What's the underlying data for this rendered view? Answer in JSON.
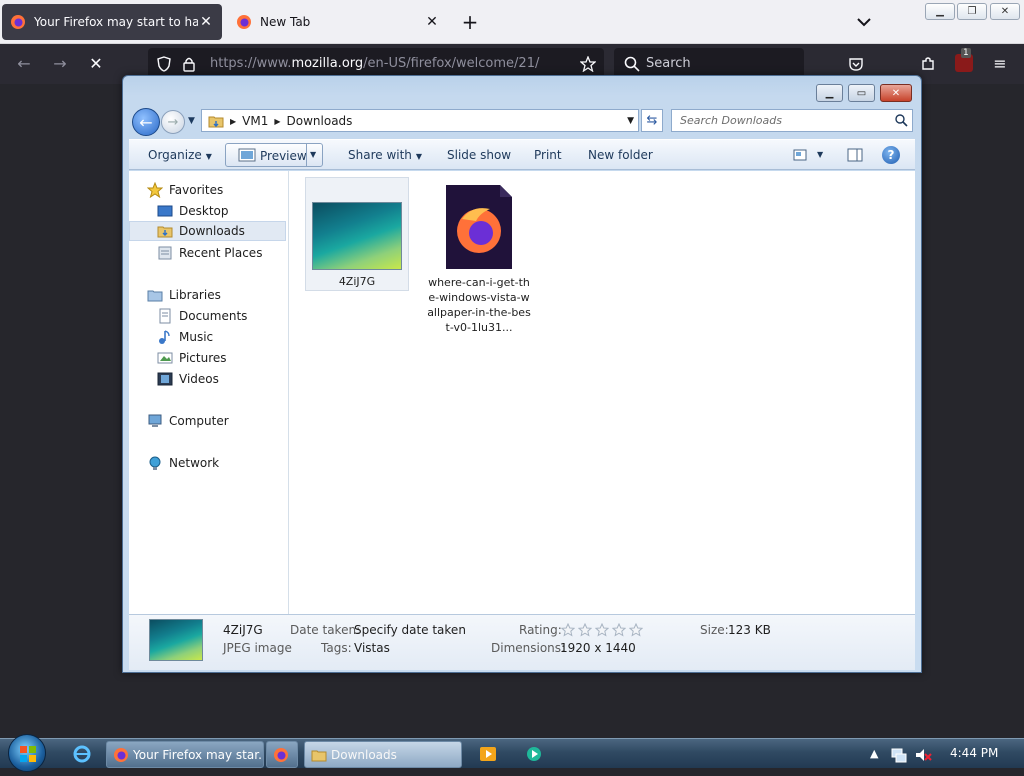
{
  "firefox": {
    "tabs": [
      {
        "label": "Your Firefox may start to have p",
        "active": true
      },
      {
        "label": "New Tab",
        "active": false
      }
    ],
    "url": {
      "prefix": "https://www.",
      "domain": "mozilla.org",
      "path": "/en-US/firefox/welcome/21/"
    },
    "search_placeholder": "Search",
    "badge_count": "1"
  },
  "explorer": {
    "breadcrumbs": [
      "VM1",
      "Downloads"
    ],
    "search_placeholder": "Search Downloads",
    "commands": {
      "organize": "Organize",
      "preview": "Preview",
      "share_with": "Share with",
      "slide_show": "Slide show",
      "print": "Print",
      "new_folder": "New folder"
    },
    "nav": {
      "favorites": "Favorites",
      "desktop": "Desktop",
      "downloads": "Downloads",
      "recent_places": "Recent Places",
      "libraries": "Libraries",
      "documents": "Documents",
      "music": "Music",
      "pictures": "Pictures",
      "videos": "Videos",
      "computer": "Computer",
      "network": "Network"
    },
    "files": [
      {
        "name": "4ZiJ7G",
        "icon": "jpeg-thumbnail",
        "selected": true
      },
      {
        "name": "where-can-i-get-the-windows-vista-wallpaper-in-the-best-v0-1lu31...",
        "icon": "firefox-document-icon",
        "selected": false
      }
    ],
    "details": {
      "name": "4ZiJ7G",
      "type": "JPEG image",
      "date_taken_label": "Date taken:",
      "date_taken_value": "Specify date taken",
      "tags_label": "Tags:",
      "tags_value": "Vistas",
      "rating_label": "Rating:",
      "rating_stars": 0,
      "dimensions_label": "Dimensions:",
      "dimensions_value": "1920 x 1440",
      "size_label": "Size:",
      "size_value": "123 KB"
    }
  },
  "taskbar": {
    "buttons": [
      {
        "label": "Your Firefox may star..."
      },
      {
        "label": ""
      },
      {
        "label": "Downloads"
      }
    ],
    "clock": "4:44 PM"
  }
}
